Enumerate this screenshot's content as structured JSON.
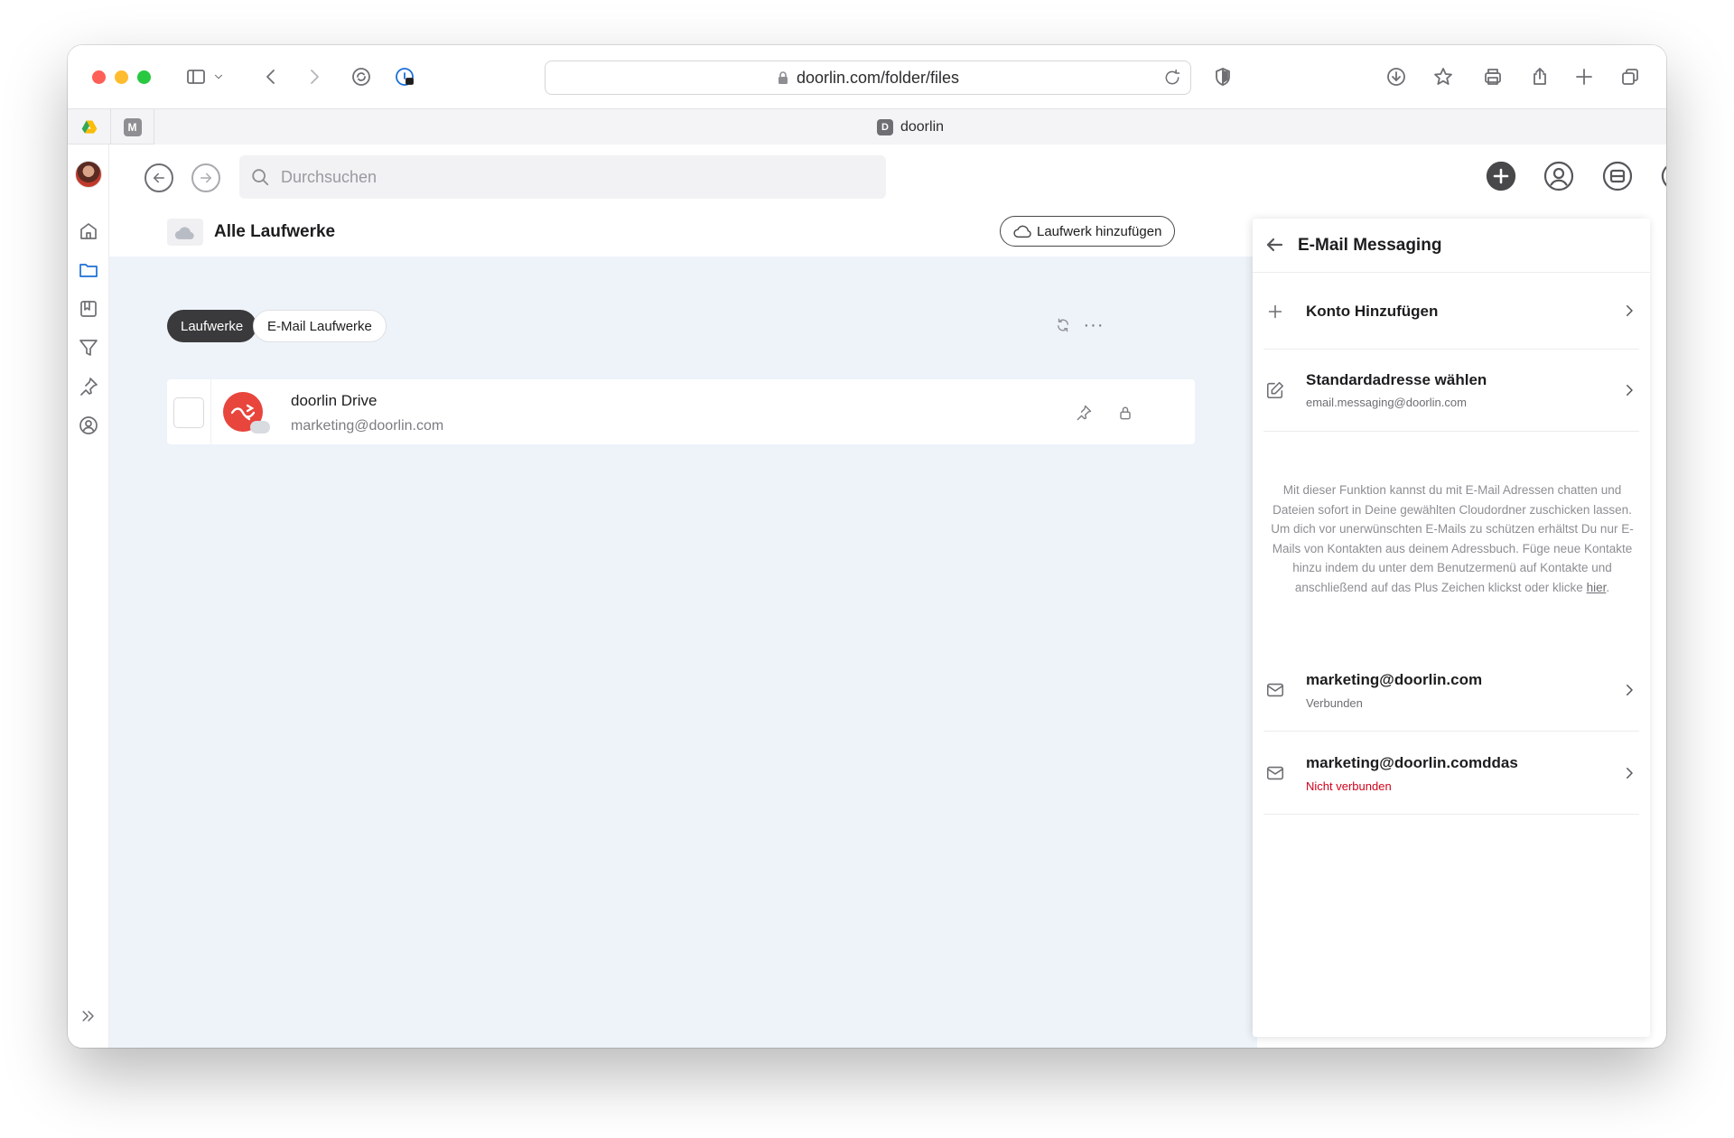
{
  "browser": {
    "url": "doorlin.com/folder/files",
    "pinned_tabs": [
      {
        "icon": "google-drive-icon"
      },
      {
        "letter": "M"
      }
    ],
    "active_tab": {
      "favicon_letter": "D",
      "title": "doorlin"
    }
  },
  "topbar": {
    "search_placeholder": "Durchsuchen"
  },
  "main": {
    "title": "Alle Laufwerke",
    "add_drive_label": "Laufwerk hinzufügen",
    "tabs": [
      {
        "label": "Laufwerke",
        "active": true
      },
      {
        "label": "E-Mail Laufwerke",
        "active": false
      }
    ],
    "more_label": "···",
    "drives": [
      {
        "name": "doorlin Drive",
        "account": "marketing@doorlin.com"
      }
    ]
  },
  "panel": {
    "title": "E-Mail Messaging",
    "items": [
      {
        "label": "Konto Hinzufügen",
        "icon": "plus-icon"
      },
      {
        "label": "Standardadresse wählen",
        "sub": "email.messaging@doorlin.com",
        "icon": "edit-icon"
      }
    ],
    "description": "Mit dieser Funktion kannst du mit E-Mail Adressen chatten und Dateien sofort in Deine gewählten Cloudordner zuschicken lassen. Um dich vor unerwünschten E-Mails zu schützen erhältst Du nur E-Mails von Kontakten aus deinem Adressbuch. Füge neue Kontakte hinzu indem du unter dem Benutzermenü auf Kontakte und anschließend auf das Plus Zeichen klickst oder klicke",
    "description_link": "hier",
    "description_end": ".",
    "accounts": [
      {
        "email": "marketing@doorlin.com",
        "status": "Verbunden",
        "connected": true
      },
      {
        "email": "marketing@doorlin.comddas",
        "status": "Nicht verbunden",
        "connected": false
      }
    ]
  },
  "colors": {
    "accent": "#1b6fd6",
    "main_bg": "#eef3fa",
    "brand_red": "#e8453c",
    "error_red": "#d0021b"
  }
}
